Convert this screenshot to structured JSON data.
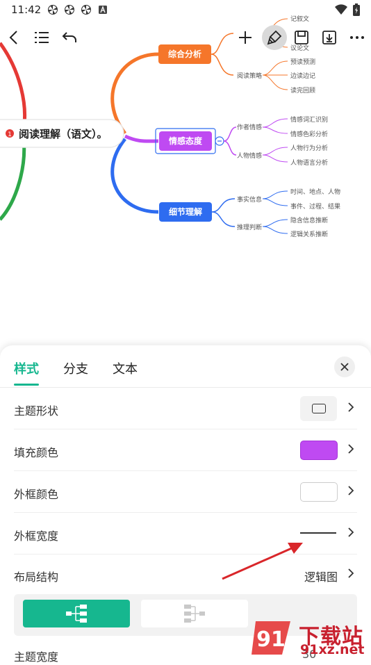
{
  "status_bar": {
    "time": "11:42",
    "left_icons": [
      "pinwheel-icon",
      "pinwheel-icon",
      "pinwheel-icon",
      "font-a-icon"
    ],
    "right_icons": [
      "wifi-icon",
      "battery-icon"
    ]
  },
  "toolbar": {
    "icons": [
      "back-chevron-icon",
      "outline-list-icon",
      "undo-icon",
      "add-icon",
      "format-brush-icon",
      "save-icon",
      "export-icon",
      "more-icon"
    ]
  },
  "mindmap": {
    "root": {
      "label": "阅读理解（语文）。",
      "badge": "1",
      "color": "#e53935"
    },
    "branches": [
      {
        "label": "综合分析",
        "color": "#f5762a",
        "children": [
          {
            "label": "",
            "leaves": [
              "记叙文",
              "",
              "议论文"
            ]
          },
          {
            "label": "阅读策略",
            "leaves": [
              "预读预测",
              "边读边记",
              "读完回顾"
            ]
          }
        ]
      },
      {
        "label": "情感态度",
        "color": "#bf4af2",
        "children": [
          {
            "label": "作者情感",
            "leaves": [
              "情感词汇识别",
              "情感色彩分析"
            ]
          },
          {
            "label": "人物情感",
            "leaves": [
              "人物行为分析",
              "人物语言分析"
            ]
          }
        ]
      },
      {
        "label": "细节理解",
        "color": "#2e6cf0",
        "children": [
          {
            "label": "事实信息",
            "leaves": [
              "时间、地点、人物",
              "事件、过程、结果"
            ]
          },
          {
            "label": "推理判断",
            "leaves": [
              "隐含信息推断",
              "逻辑关系推断"
            ]
          }
        ]
      }
    ]
  },
  "panel": {
    "tabs": [
      {
        "label": "样式",
        "active": true
      },
      {
        "label": "分支",
        "active": false
      },
      {
        "label": "文本",
        "active": false
      }
    ],
    "rows": {
      "topic_shape": "主题形状",
      "fill_color": "填充颜色",
      "border_color": "外框颜色",
      "border_width": "外框宽度",
      "layout": "布局结构",
      "layout_value": "逻辑图",
      "topic_width": "主题宽度",
      "topic_width_value": "30"
    },
    "fill_color_value": "#bf4af2",
    "accent_color": "#16b78f"
  },
  "watermark": {
    "text": "下载站",
    "url": "91xz.net",
    "logo_text": "91"
  }
}
